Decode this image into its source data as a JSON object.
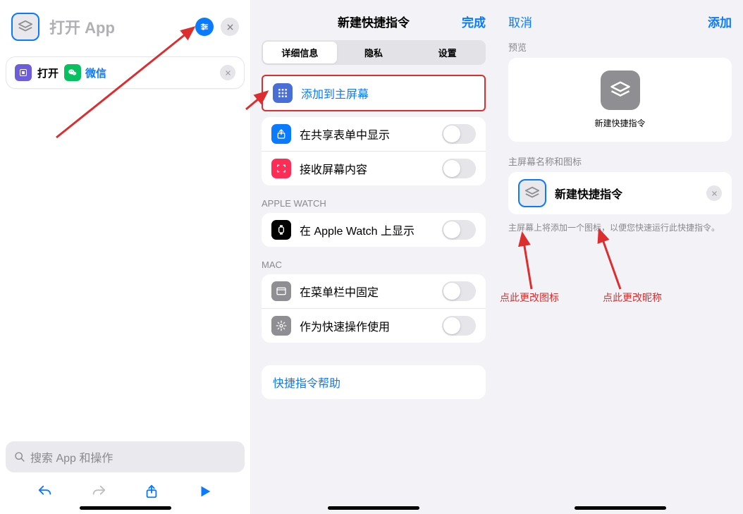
{
  "p1": {
    "title": "打开 App",
    "action_open": "打开",
    "action_app": "微信",
    "search_placeholder": "搜索 App 和操作"
  },
  "p2": {
    "title": "新建快捷指令",
    "done": "完成",
    "seg_detail": "详细信息",
    "seg_privacy": "隐私",
    "seg_settings": "设置",
    "row_home": "添加到主屏幕",
    "row_share": "在共享表单中显示",
    "row_receive": "接收屏幕内容",
    "sec_watch": "APPLE WATCH",
    "row_watch": "在 Apple Watch 上显示",
    "sec_mac": "MAC",
    "row_menubar": "在菜单栏中固定",
    "row_quick": "作为快速操作使用",
    "help": "快捷指令帮助"
  },
  "p3": {
    "cancel": "取消",
    "add": "添加",
    "preview_label": "预览",
    "preview_name": "新建快捷指令",
    "section_label": "主屏幕名称和图标",
    "edit_name": "新建快捷指令",
    "hint": "主屏幕上将添加一个图标，以便您快速运行此快捷指令。",
    "annot_icon": "点此更改图标",
    "annot_name": "点此更改昵称"
  }
}
